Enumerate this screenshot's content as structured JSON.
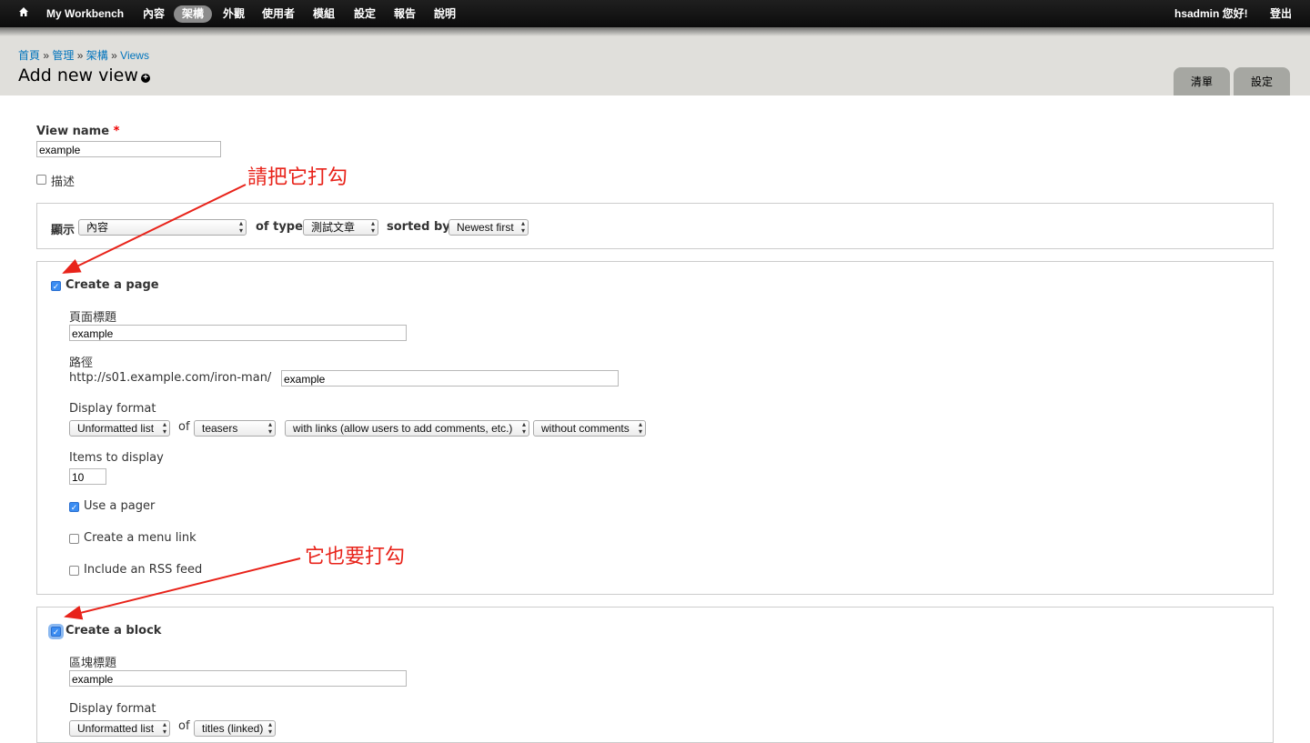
{
  "toolbar": {
    "items": [
      "My Workbench",
      "內容",
      "架構",
      "外觀",
      "使用者",
      "模組",
      "設定",
      "報告",
      "說明"
    ],
    "user": "hsadmin 您好!",
    "logout": "登出"
  },
  "breadcrumb": {
    "items": [
      "首頁",
      "管理",
      "架構",
      "Views"
    ],
    "separator": "»"
  },
  "page_title": "Add new view",
  "tabs": [
    "清單",
    "設定"
  ],
  "form": {
    "view_name_label": "View name",
    "required_mark": "*",
    "view_name_value": "example",
    "description_label": "描述",
    "show_label": "顯示",
    "show_value": "內容",
    "of_type_label": "of type",
    "of_type_value": "測試文章",
    "sorted_by_label": "sorted by",
    "sorted_by_value": "Newest first",
    "page": {
      "create_label": "Create a page",
      "title_label": "頁面標題",
      "title_value": "example",
      "path_label": "路徑",
      "path_prefix": "http://s01.example.com/iron-man/",
      "path_value": "example",
      "display_format_label": "Display format",
      "format_value": "Unformatted list",
      "of_label": "of",
      "row_value": "teasers",
      "links_value": "with links (allow users to add comments, etc.)",
      "comments_value": "without comments",
      "items_label": "Items to display",
      "items_value": "10",
      "pager_label": "Use a pager",
      "menu_label": "Create a menu link",
      "rss_label": "Include an RSS feed"
    },
    "block": {
      "create_label": "Create a block",
      "title_label": "區塊標題",
      "title_value": "example",
      "display_format_label": "Display format",
      "format_value": "Unformatted list",
      "of_label": "of",
      "row_value": "titles (linked)"
    }
  },
  "annotations": {
    "first": "請把它打勾",
    "second": "它也要打勾"
  },
  "colors": {
    "annotation": "#e8231a",
    "link": "#0074bd",
    "checkbox": "#3b8df2"
  }
}
